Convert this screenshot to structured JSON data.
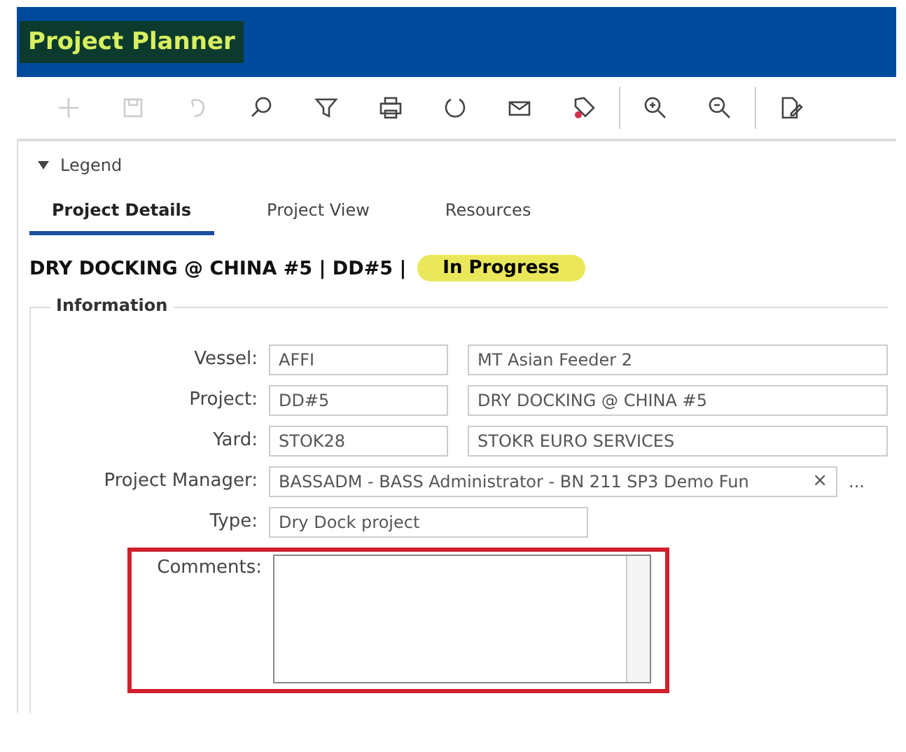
{
  "window": {
    "title": "Project Planner"
  },
  "toolbar": [
    {
      "kind": "add",
      "disabled": true
    },
    {
      "kind": "save",
      "disabled": true
    },
    {
      "kind": "undo",
      "disabled": true
    },
    {
      "kind": "search",
      "disabled": false
    },
    {
      "kind": "filter",
      "disabled": false
    },
    {
      "kind": "print",
      "disabled": false
    },
    {
      "kind": "refresh",
      "disabled": false
    },
    {
      "kind": "mail",
      "disabled": false
    },
    {
      "kind": "tag",
      "disabled": false
    },
    {
      "kind": "sep"
    },
    {
      "kind": "zoomin",
      "disabled": false
    },
    {
      "kind": "zoomout",
      "disabled": false
    },
    {
      "kind": "sep"
    },
    {
      "kind": "edit",
      "disabled": false
    }
  ],
  "legend": {
    "label": "Legend",
    "expanded": true
  },
  "tabs": [
    {
      "label": "Project Details",
      "selected": true
    },
    {
      "label": "Project View",
      "selected": false
    },
    {
      "label": "Resources",
      "selected": false
    }
  ],
  "heading": {
    "title": "DRY DOCKING @ CHINA #5 | DD#5 |",
    "status": "In Progress"
  },
  "group": {
    "title": "Information",
    "rows": [
      {
        "kind": "pair",
        "label": "Vessel:",
        "code": "AFFI",
        "name": "MT Asian Feeder 2"
      },
      {
        "kind": "pair",
        "label": "Project:",
        "code": "DD#5",
        "name": "DRY DOCKING @ CHINA #5"
      },
      {
        "kind": "pair",
        "label": "Yard:",
        "code": "STOK28",
        "name": "STOKR EURO SERVICES"
      },
      {
        "kind": "lookup",
        "label": "Project Manager:",
        "value": "BASSADM - BASS Administrator - BN 211 SP3 Demo Fun",
        "clear": "×",
        "more": "..."
      },
      {
        "kind": "single",
        "label": "Type:",
        "value": "Dry Dock project"
      },
      {
        "kind": "memo",
        "label": "Comments:",
        "value": "",
        "highlighted": true
      }
    ]
  }
}
